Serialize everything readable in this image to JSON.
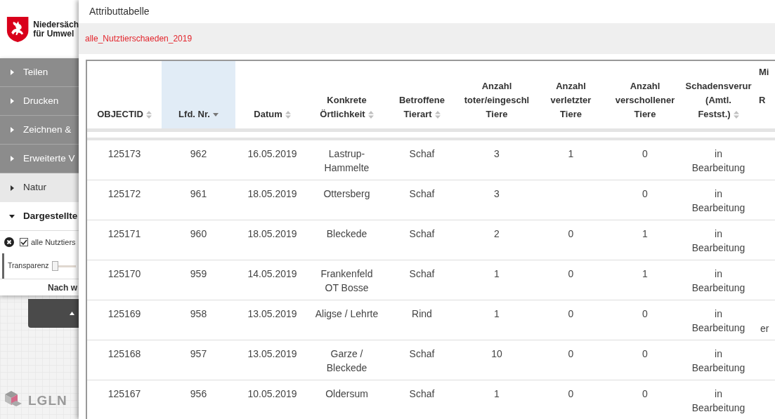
{
  "sidebar": {
    "logo_lines": [
      "Niedersäch",
      "für Umwel"
    ],
    "menu": [
      {
        "label": "Teilen",
        "kind": "tool",
        "expanded": false
      },
      {
        "label": "Drucken",
        "kind": "tool",
        "expanded": false
      },
      {
        "label": "Zeichnen &",
        "kind": "tool",
        "expanded": false
      },
      {
        "label": "Erweiterte V",
        "kind": "tool",
        "expanded": false
      },
      {
        "label": "Natur",
        "kind": "theme",
        "expanded": false
      },
      {
        "label": "Dargestellte",
        "kind": "layers",
        "expanded": true
      }
    ],
    "layer": {
      "name": "alle Nutztiers",
      "checked": true
    },
    "transparency": {
      "label": "Transparenz",
      "level": 0
    },
    "order_label": "Nach w",
    "brand": "LGLN"
  },
  "window": {
    "title": "Attributtabelle",
    "layer_name": "alle_Nutztierschaeden_2019"
  },
  "table": {
    "columns": [
      {
        "header": "OBJECTID",
        "sortable": true,
        "selected": false
      },
      {
        "header": "Lfd. Nr.",
        "sortable": true,
        "selected": true
      },
      {
        "header": "Datum",
        "sortable": true,
        "selected": false
      },
      {
        "header": "Konkrete\nÖrtlichkeit",
        "sortable": true,
        "selected": false
      },
      {
        "header": "Betroffene\nTierart",
        "sortable": true,
        "selected": false
      },
      {
        "header": "Anzahl\ntoter/eingeschl\nTiere",
        "sortable": false,
        "selected": false
      },
      {
        "header": "Anzahl\nverletzter\nTiere",
        "sortable": false,
        "selected": false
      },
      {
        "header": "Anzahl\nverschollener\nTiere",
        "sortable": false,
        "selected": false
      },
      {
        "header": "Schadensverur\n(Amtl.\nFestst.)",
        "sortable": true,
        "selected": false
      },
      {
        "header": "Mi\n\nR",
        "sortable": false,
        "selected": false
      }
    ],
    "rows": [
      [
        "125173",
        "962",
        "16.05.2019",
        "Lastrup-\nHammelte",
        "Schaf",
        "3",
        "1",
        "0",
        "in\nBearbeitung",
        null
      ],
      [
        "125172",
        "961",
        "18.05.2019",
        "Ottersberg",
        "Schaf",
        "3",
        null,
        "0",
        "in\nBearbeitung",
        null
      ],
      [
        "125171",
        "960",
        "18.05.2019",
        "Bleckede",
        "Schaf",
        "2",
        "0",
        "1",
        "in\nBearbeitung",
        null
      ],
      [
        "125170",
        "959",
        "14.05.2019",
        "Frankenfeld\nOT Bosse",
        "Schaf",
        "1",
        "0",
        "1",
        "in\nBearbeitung",
        null
      ],
      [
        "125169",
        "958",
        "13.05.2019",
        "Aligse / Lehrte",
        "Rind",
        "1",
        "0",
        "0",
        "in\nBearbeitung",
        "er"
      ],
      [
        "125168",
        "957",
        "13.05.2019",
        "Garze /\nBleckede",
        "Schaf",
        "10",
        "0",
        "0",
        "in\nBearbeitung",
        null
      ],
      [
        "125167",
        "956",
        "10.05.2019",
        "Oldersum",
        "Schaf",
        "1",
        "0",
        "0",
        "in\nBearbeitung",
        null
      ]
    ]
  }
}
